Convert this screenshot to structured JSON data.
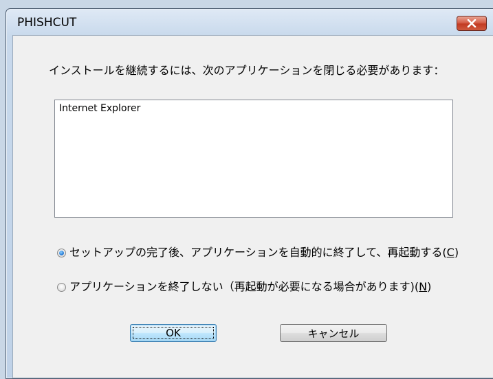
{
  "window": {
    "title": "PHISHCUT"
  },
  "dialog": {
    "message": "インストールを継続するには、次のアプリケーションを閉じる必要があります：",
    "applications": [
      "Internet Explorer"
    ],
    "options": [
      {
        "label_main": "セットアップの完了後、アプリケーションを自動的に終了して、再起動する(",
        "accel": "C",
        "label_end": ")",
        "checked": true
      },
      {
        "label_main": "アプリケーションを終了しない（再起動が必要になる場合があります)(",
        "accel": "N",
        "label_end": ")",
        "checked": false
      }
    ],
    "ok_label": "OK",
    "cancel_label": "キャンセル"
  },
  "colors": {
    "close_button": "#c23a22",
    "default_button_border": "#3c7fb1",
    "radio_checked": "#2a7fd8"
  },
  "icons": {
    "close": "close-x-icon"
  }
}
